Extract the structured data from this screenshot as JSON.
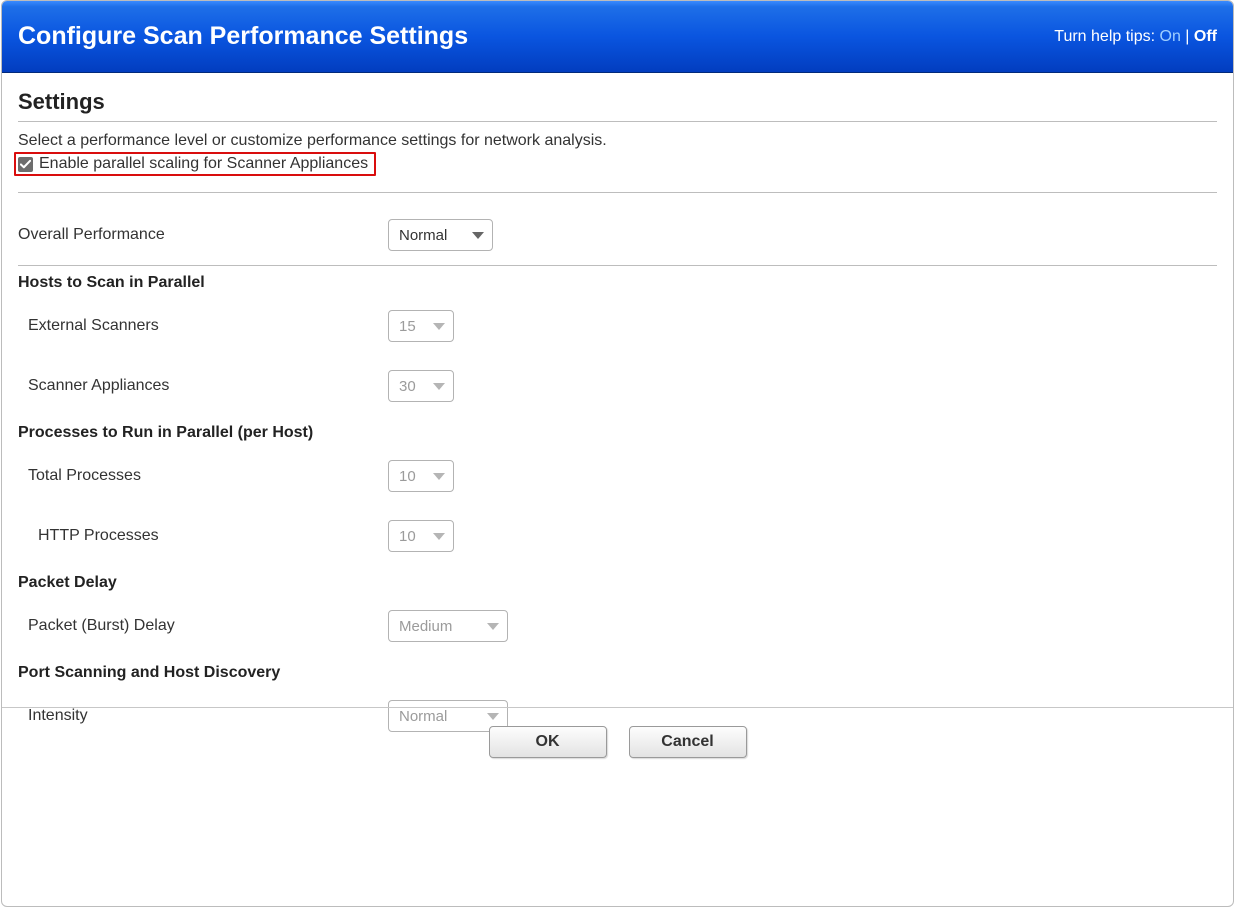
{
  "header": {
    "title": "Configure Scan Performance Settings",
    "help_tips_prefix": "Turn help tips: ",
    "help_tips_on": "On",
    "help_tips_sep": " | ",
    "help_tips_off": "Off"
  },
  "settings": {
    "section_title": "Settings",
    "description": "Select a performance level or customize performance settings for network analysis.",
    "enable_parallel_label": "Enable parallel scaling for Scanner Appliances",
    "enable_parallel_checked": true
  },
  "overall_performance": {
    "label": "Overall Performance",
    "value": "Normal"
  },
  "hosts_parallel": {
    "title": "Hosts to Scan in Parallel",
    "external_scanners": {
      "label": "External Scanners",
      "value": "15"
    },
    "scanner_appliances": {
      "label": "Scanner Appliances",
      "value": "30"
    }
  },
  "processes_parallel": {
    "title": "Processes to Run in Parallel (per Host)",
    "total_processes": {
      "label": "Total Processes",
      "value": "10"
    },
    "http_processes": {
      "label": "HTTP Processes",
      "value": "10"
    }
  },
  "packet_delay": {
    "title": "Packet Delay",
    "burst_delay": {
      "label": "Packet (Burst) Delay",
      "value": "Medium"
    }
  },
  "port_scanning": {
    "title": "Port Scanning and Host Discovery",
    "intensity": {
      "label": "Intensity",
      "value": "Normal"
    }
  },
  "buttons": {
    "ok": "OK",
    "cancel": "Cancel"
  }
}
